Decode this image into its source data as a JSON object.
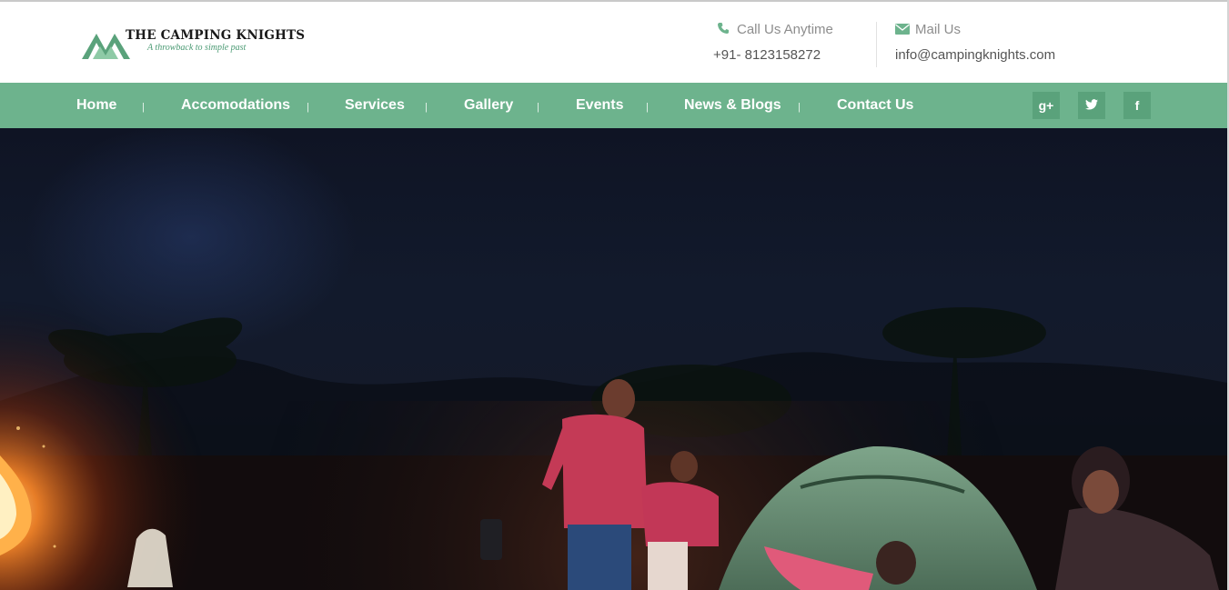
{
  "brand": {
    "title": "THE CAMPING KNIGHTS",
    "tagline": "A throwback to simple past",
    "accent": "#6db38d"
  },
  "contact": {
    "phone_label": "Call Us Anytime",
    "phone_value": "+91- 8123158272",
    "phone_icon": "phone-icon",
    "mail_label": "Mail Us",
    "mail_value": "info@campingknights.com",
    "mail_icon": "envelope-icon"
  },
  "nav": {
    "items": [
      {
        "label": "Home"
      },
      {
        "label": "Accomodations"
      },
      {
        "label": "Services"
      },
      {
        "label": "Gallery"
      },
      {
        "label": "Events"
      },
      {
        "label": "News & Blogs"
      },
      {
        "label": "Contact Us"
      }
    ],
    "separator": "|",
    "social": [
      {
        "name": "google-plus-icon",
        "glyph": "g+"
      },
      {
        "name": "twitter-icon"
      },
      {
        "name": "facebook-icon",
        "glyph": "f"
      }
    ]
  },
  "hero": {
    "scene": "night-campfire-photo",
    "colors": {
      "sky": "#121a2c",
      "fire": "#ff9a3c",
      "tent": "#6f9880"
    }
  }
}
